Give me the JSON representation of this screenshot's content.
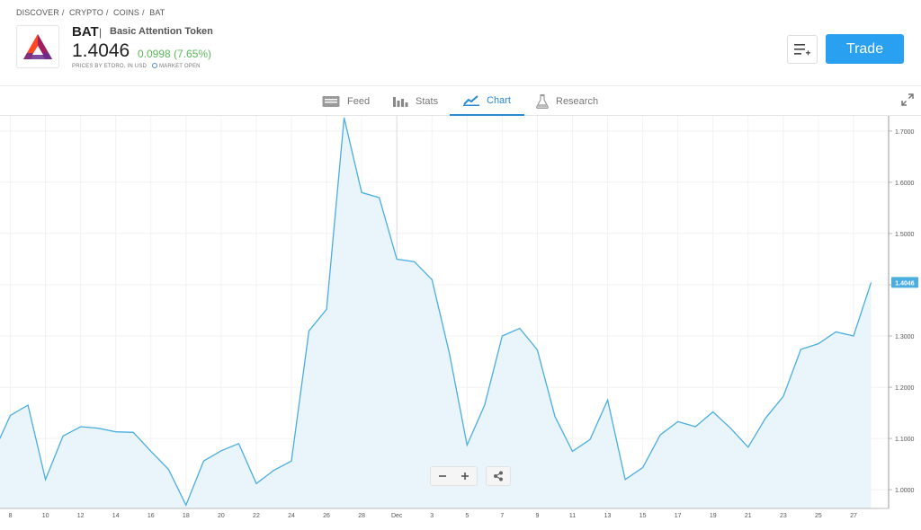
{
  "breadcrumb": [
    "DISCOVER",
    "CRYPTO",
    "COINS",
    "BAT"
  ],
  "instrument": {
    "ticker": "BAT",
    "separator": "|",
    "name": "Basic Attention Token",
    "price": "1.4046",
    "change": "0.0998 (7.65%)",
    "prices_note": "PRICES BY ETORO, IN USD",
    "market_status": "MARKET OPEN"
  },
  "actions": {
    "trade_label": "Trade"
  },
  "tabs": [
    {
      "label": "Feed",
      "icon": "feed-icon",
      "active": false
    },
    {
      "label": "Stats",
      "icon": "stats-icon",
      "active": false
    },
    {
      "label": "Chart",
      "icon": "chart-icon",
      "active": true
    },
    {
      "label": "Research",
      "icon": "research-icon",
      "active": false
    }
  ],
  "colors": {
    "accent": "#2aa0f0",
    "positive": "#5cb85c",
    "line": "#4aaee0",
    "fill": "#eaf4fb"
  },
  "chart_data": {
    "type": "area",
    "x_ticks": [
      "8",
      "10",
      "12",
      "14",
      "16",
      "18",
      "20",
      "22",
      "24",
      "26",
      "28",
      "Dec",
      "3",
      "5",
      "7",
      "9",
      "11",
      "13",
      "15",
      "17",
      "19",
      "21",
      "23",
      "25",
      "27"
    ],
    "y_ticks": [
      "1.7000",
      "1.6000",
      "1.5000",
      "1.4000",
      "1.3000",
      "1.2000",
      "1.1000",
      "1.0000"
    ],
    "ylim": [
      0.97,
      1.73
    ],
    "current_label": "1.4046",
    "series": [
      {
        "x": "7",
        "y": 1.07
      },
      {
        "x": "8",
        "y": 1.145
      },
      {
        "x": "9",
        "y": 1.165
      },
      {
        "x": "10",
        "y": 1.02
      },
      {
        "x": "11",
        "y": 1.105
      },
      {
        "x": "12",
        "y": 1.123
      },
      {
        "x": "13",
        "y": 1.12
      },
      {
        "x": "14",
        "y": 1.113
      },
      {
        "x": "15",
        "y": 1.112
      },
      {
        "x": "16",
        "y": 1.075
      },
      {
        "x": "17",
        "y": 1.04
      },
      {
        "x": "18",
        "y": 0.97
      },
      {
        "x": "19",
        "y": 1.056
      },
      {
        "x": "20",
        "y": 1.076
      },
      {
        "x": "21",
        "y": 1.09
      },
      {
        "x": "22",
        "y": 1.012
      },
      {
        "x": "23",
        "y": 1.038
      },
      {
        "x": "24",
        "y": 1.056
      },
      {
        "x": "25",
        "y": 1.31
      },
      {
        "x": "26",
        "y": 1.352
      },
      {
        "x": "27",
        "y": 1.726
      },
      {
        "x": "28",
        "y": 1.58
      },
      {
        "x": "29",
        "y": 1.57
      },
      {
        "x": "30",
        "y": 1.45
      },
      {
        "x": "Dec 1",
        "y": 1.445
      },
      {
        "x": "2",
        "y": 1.41
      },
      {
        "x": "3",
        "y": 1.265
      },
      {
        "x": "4",
        "y": 1.087
      },
      {
        "x": "5",
        "y": 1.165
      },
      {
        "x": "6",
        "y": 1.3
      },
      {
        "x": "7",
        "y": 1.315
      },
      {
        "x": "8",
        "y": 1.273
      },
      {
        "x": "9",
        "y": 1.143
      },
      {
        "x": "10",
        "y": 1.075
      },
      {
        "x": "11",
        "y": 1.098
      },
      {
        "x": "12",
        "y": 1.175
      },
      {
        "x": "13",
        "y": 1.02
      },
      {
        "x": "14",
        "y": 1.043
      },
      {
        "x": "15",
        "y": 1.107
      },
      {
        "x": "16",
        "y": 1.133
      },
      {
        "x": "17",
        "y": 1.123
      },
      {
        "x": "18",
        "y": 1.152
      },
      {
        "x": "19",
        "y": 1.12
      },
      {
        "x": "20",
        "y": 1.083
      },
      {
        "x": "21",
        "y": 1.14
      },
      {
        "x": "22",
        "y": 1.182
      },
      {
        "x": "23",
        "y": 1.274
      },
      {
        "x": "24",
        "y": 1.285
      },
      {
        "x": "25",
        "y": 1.308
      },
      {
        "x": "26",
        "y": 1.3
      },
      {
        "x": "27",
        "y": 1.4046
      }
    ],
    "grid": true
  }
}
